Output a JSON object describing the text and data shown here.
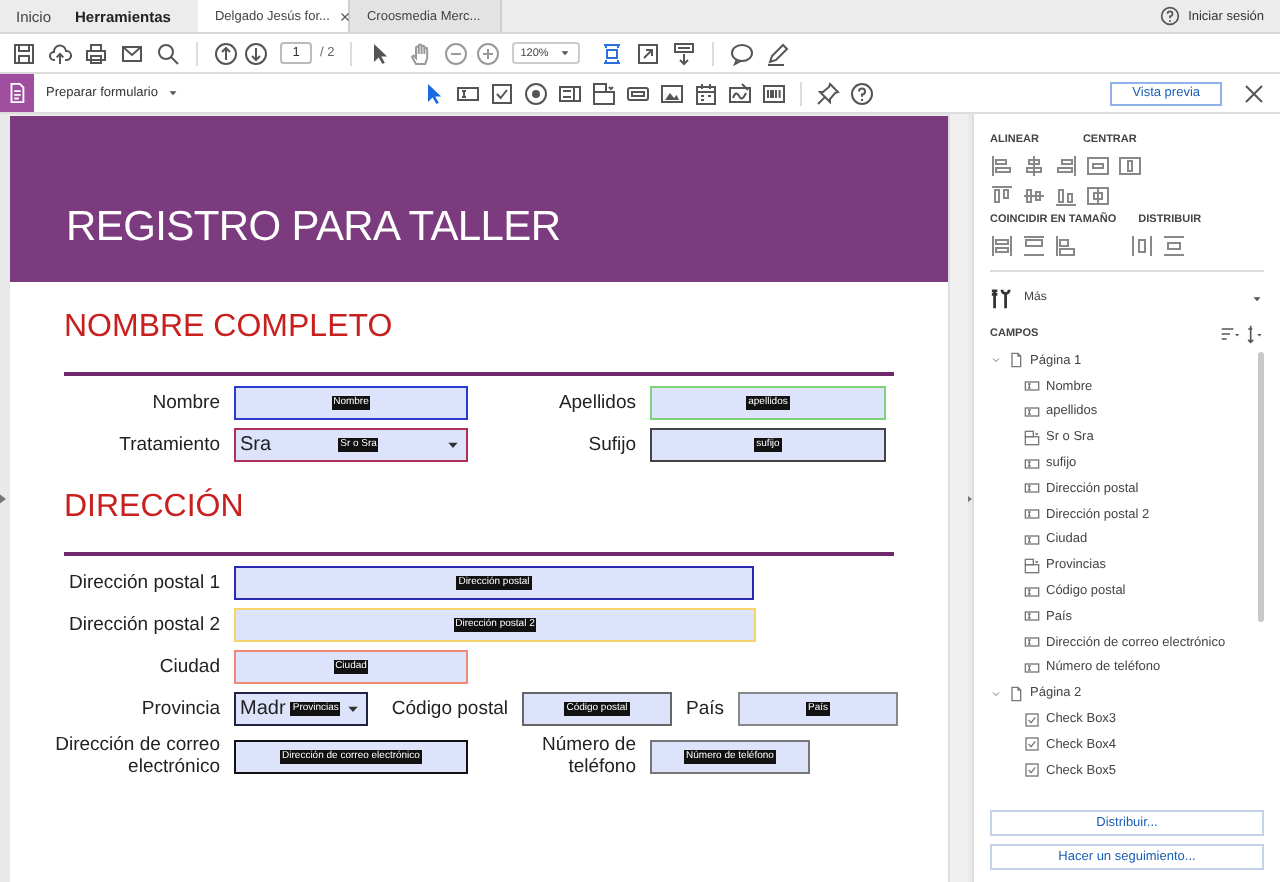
{
  "top_bar": {
    "nav": [
      {
        "label": "Inicio",
        "selected": false
      },
      {
        "label": "Herramientas",
        "selected": true
      }
    ],
    "documents": [
      {
        "title": "Delgado Jesús for...",
        "closable": true,
        "selected": true
      },
      {
        "title": "Croosmedia Merc...",
        "closable": false,
        "selected": false
      }
    ],
    "sign_in": "Iniciar sesión"
  },
  "toolbar": {
    "page": "1",
    "page_total": "/ 2",
    "zoom": "120%"
  },
  "form_toolbar": {
    "title": "Preparar formulario",
    "preview": "Vista previa"
  },
  "document": {
    "title": "REGISTRO PARA TALLER",
    "sections": [
      {
        "heading": "NOMBRE COMPLETO",
        "rows": [
          {
            "items": [
              {
                "label": "Nombre",
                "field": {
                  "kind": "text",
                  "name": "Nombre",
                  "color": "#2b3bd0"
                }
              },
              {
                "label": "Apellidos",
                "field": {
                  "kind": "text",
                  "name": "apellidos",
                  "color": "#7ed37a"
                }
              }
            ]
          },
          {
            "items": [
              {
                "label": "Tratamiento",
                "field": {
                  "kind": "dropdown",
                  "name": "Sr o Sra",
                  "value": "Sra",
                  "color": "#b0305a"
                }
              },
              {
                "label": "Sufijo",
                "field": {
                  "kind": "text",
                  "name": "sufijo",
                  "color": "#444444"
                }
              }
            ]
          }
        ]
      },
      {
        "heading": "DIRECCIÓN",
        "rows": [
          {
            "items": [
              {
                "label": "Dirección postal 1",
                "field": {
                  "kind": "text",
                  "name": "Dirección postal",
                  "color": "#2a2ab0"
                }
              }
            ]
          },
          {
            "items": [
              {
                "label": "Dirección postal 2",
                "field": {
                  "kind": "text",
                  "name": "Dirección postal 2",
                  "color": "#f5d36a"
                }
              }
            ]
          },
          {
            "items": [
              {
                "label": "Ciudad",
                "field": {
                  "kind": "text",
                  "name": "Ciudad",
                  "color": "#f08878"
                }
              }
            ]
          },
          {
            "items": [
              {
                "label": "Provincia",
                "field": {
                  "kind": "dropdown",
                  "name": "Provincias",
                  "value": "Madr",
                  "color": "#222244"
                }
              },
              {
                "label": "Código postal",
                "field": {
                  "kind": "text",
                  "name": "Código postal",
                  "color": "#666666"
                }
              },
              {
                "label": "País",
                "field": {
                  "kind": "text",
                  "name": "País",
                  "color": "#888888"
                }
              }
            ]
          },
          {
            "items": [
              {
                "label": "Dirección de correo electrónico",
                "field": {
                  "kind": "text",
                  "name": "Dirección de correo electrónico",
                  "color": "#111111"
                }
              },
              {
                "label": "Número de teléfono",
                "field": {
                  "kind": "text",
                  "name": "Número de teléfono",
                  "color": "#777777"
                }
              }
            ]
          }
        ]
      }
    ]
  },
  "panel": {
    "align_heading": "ALINEAR",
    "center_heading": "CENTRAR",
    "size_heading": "COINCIDIR EN TAMAÑO",
    "distribute_heading": "DISTRIBUIR",
    "more": "Más",
    "fields_heading": "CAMPOS",
    "tree": [
      {
        "label": "Página 1",
        "expanded": true,
        "children": [
          {
            "label": "Nombre",
            "kind": "text"
          },
          {
            "label": "apellidos",
            "kind": "text"
          },
          {
            "label": "Sr o Sra",
            "kind": "dropdown"
          },
          {
            "label": "sufijo",
            "kind": "text"
          },
          {
            "label": "Dirección postal",
            "kind": "text"
          },
          {
            "label": "Dirección postal 2",
            "kind": "text"
          },
          {
            "label": "Ciudad",
            "kind": "text"
          },
          {
            "label": "Provincias",
            "kind": "dropdown"
          },
          {
            "label": "Código postal",
            "kind": "text"
          },
          {
            "label": "País",
            "kind": "text"
          },
          {
            "label": "Dirección de correo electrónico",
            "kind": "text"
          },
          {
            "label": "Número de teléfono",
            "kind": "text"
          }
        ]
      },
      {
        "label": "Página 2",
        "expanded": true,
        "children": [
          {
            "label": "Check Box3",
            "kind": "checkbox"
          },
          {
            "label": "Check Box4",
            "kind": "checkbox"
          },
          {
            "label": "Check Box5",
            "kind": "checkbox"
          }
        ]
      }
    ],
    "buttons": [
      "Distribuir...",
      "Hacer un seguimiento..."
    ]
  }
}
